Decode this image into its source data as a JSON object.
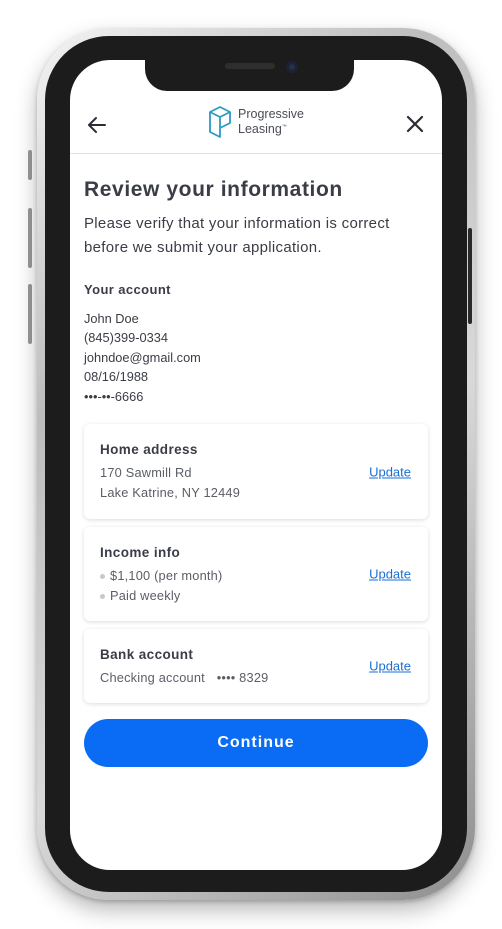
{
  "header": {
    "logo_line1": "Progressive",
    "logo_line2": "Leasing",
    "logo_mark": "™"
  },
  "page": {
    "title": "Review your information",
    "subtitle_line1": "Please verify that your information is correct",
    "subtitle_line2": "before we submit your application."
  },
  "account": {
    "label": "Your account",
    "name": "John Doe",
    "phone": "(845)399-0334",
    "email": "johndoe@gmail.com",
    "dob": "08/16/1988",
    "ssn": "•••-••-6666"
  },
  "address_card": {
    "title": "Home address",
    "line1": "170 Sawmill Rd",
    "line2": "Lake Katrine, NY 12449",
    "action": "Update"
  },
  "income_card": {
    "title": "Income info",
    "item1": "$1,100 (per month)",
    "item2": "Paid weekly",
    "action": "Update"
  },
  "bank_card": {
    "title": "Bank account",
    "account_type": "Checking account",
    "account_number": "•••• 8329",
    "action": "Update"
  },
  "continue_label": "Continue",
  "colors": {
    "primary": "#0a6cf5",
    "link": "#1a6fd6",
    "logo": "#2a9bc4",
    "text": "#3a3d45"
  },
  "icons": {
    "back": "arrow-left-icon",
    "close": "close-icon",
    "logo": "progressive-leasing-logo-icon"
  }
}
